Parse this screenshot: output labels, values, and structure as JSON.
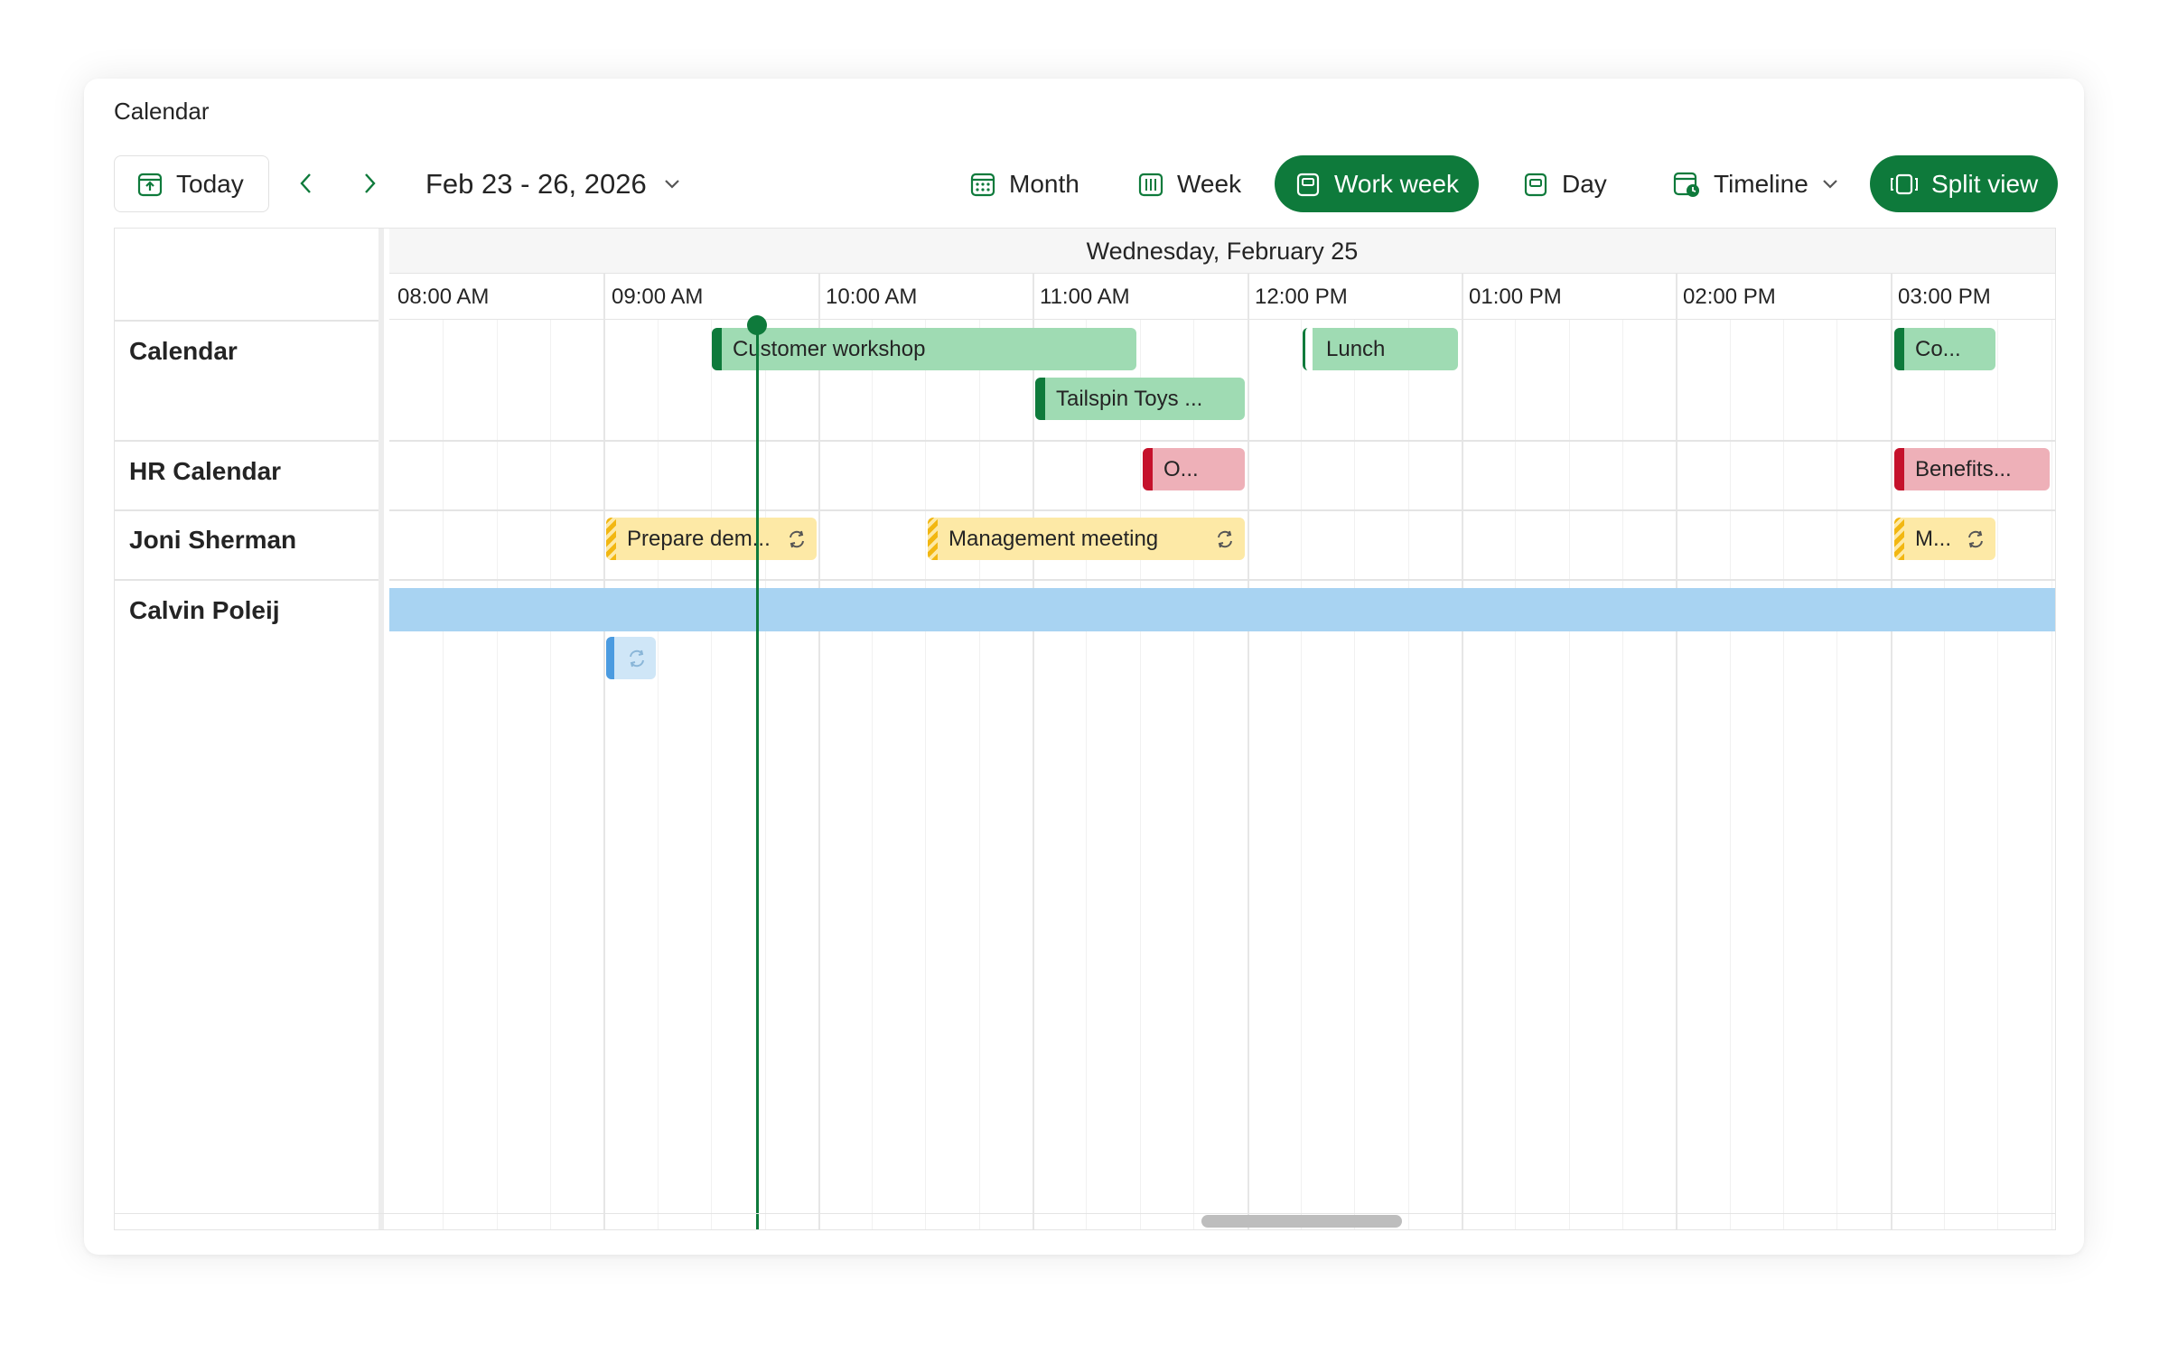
{
  "card": {
    "title": "Calendar"
  },
  "toolbar": {
    "today_label": "Today",
    "date_range": "Feb 23 - 26, 2026",
    "views": [
      {
        "label": "Month",
        "icon": "calendar-month-icon",
        "active": false
      },
      {
        "label": "Week",
        "icon": "calendar-week-icon",
        "active": false
      },
      {
        "label": "Work week",
        "icon": "calendar-work-week-icon",
        "active": true
      },
      {
        "label": "Day",
        "icon": "calendar-day-icon",
        "active": false
      },
      {
        "label": "Timeline",
        "icon": "calendar-timeline-icon",
        "active": false
      },
      {
        "label": "Split view",
        "icon": "split-view-icon",
        "active": true
      }
    ],
    "accent": "#0e7a3b"
  },
  "timeline": {
    "day_header": "Wednesday, February 25",
    "hours": [
      "08:00 AM",
      "09:00 AM",
      "10:00 AM",
      "11:00 AM",
      "12:00 PM",
      "01:00 PM",
      "02:00 PM",
      "03:00 PM"
    ]
  },
  "resources": [
    "Calendar",
    "HR Calendar",
    "Joni Sherman",
    "Calvin Poleij"
  ],
  "events": {
    "customer_workshop": "Customer workshop",
    "tailspin": "Tailspin Toys ...",
    "lunch": "Lunch",
    "co": "Co...",
    "hr_o": "O...",
    "benefits": "Benefits...",
    "prepare_demo": "Prepare dem...",
    "management_meeting": "Management meeting",
    "joni_m": "M..."
  },
  "colors": {
    "green": "#9fdbb3",
    "green_bar": "#0e7a3b",
    "red": "#eeb0b8",
    "red_bar": "#c5112b",
    "yellow": "#fde9a6",
    "yellow_bar": "#f2b712",
    "blue": "#a8d3f2"
  }
}
